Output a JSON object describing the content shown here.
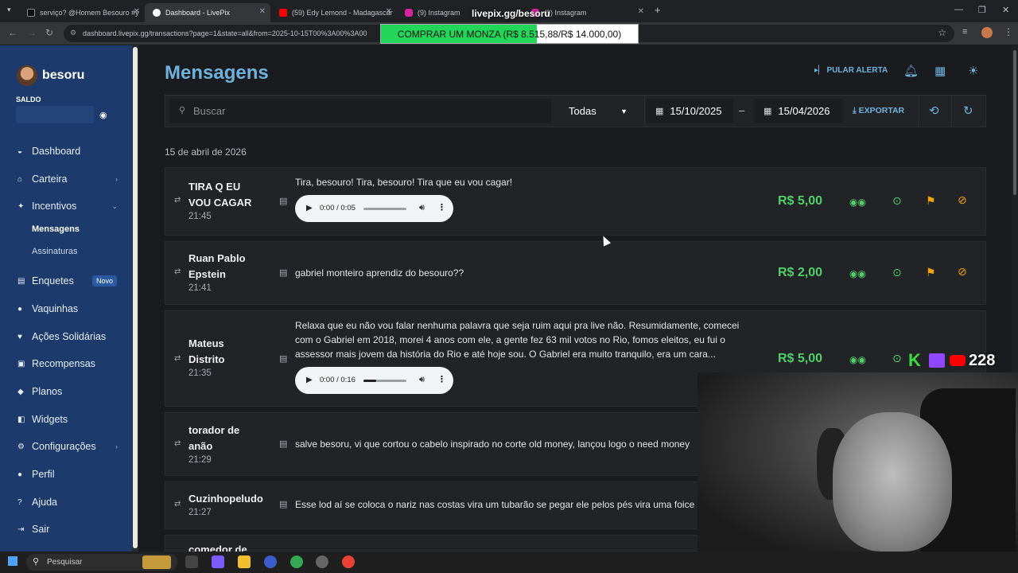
{
  "browser": {
    "tabs": [
      {
        "label": "serviço? @Homem Besouro #y"
      },
      {
        "label": "Dashboard - LivePix"
      },
      {
        "label": "(59) Edy Lemond - Madagascar"
      },
      {
        "label": "(9) Instagram"
      },
      {
        "label": "(9) Instagram"
      }
    ],
    "new_tab": "+",
    "url": "dashboard.livepix.gg/transactions?page=1&state=all&from=2025-10-15T00%3A00%3A00"
  },
  "overlay": {
    "goal_text": "COMPRAR UM MONZA (R$ 8.515,88/R$ 14.000,00)",
    "goal_progress": 0.608,
    "channel_url": "livepix.gg/besoru"
  },
  "sidebar": {
    "username": "besoru",
    "saldo_label": "SALDO",
    "items": [
      {
        "label": "Dashboard",
        "icon": "dashboard-icon"
      },
      {
        "label": "Carteira",
        "icon": "bank-icon"
      },
      {
        "label": "Incentivos",
        "icon": "sparkle-icon"
      },
      {
        "label": "Enquetes",
        "icon": "poll-icon",
        "badge": "Novo"
      },
      {
        "label": "Vaquinhas",
        "icon": "piggy-icon"
      },
      {
        "label": "Ações Solidárias",
        "icon": "heart-icon"
      },
      {
        "label": "Recompensas",
        "icon": "gift-icon"
      },
      {
        "label": "Planos",
        "icon": "plans-icon"
      },
      {
        "label": "Widgets",
        "icon": "widgets-icon"
      },
      {
        "label": "Configurações",
        "icon": "gear-icon"
      },
      {
        "label": "Perfil",
        "icon": "user-icon"
      },
      {
        "label": "Ajuda",
        "icon": "help-icon"
      },
      {
        "label": "Sair",
        "icon": "logout-icon"
      }
    ],
    "subitems": [
      {
        "label": "Mensagens"
      },
      {
        "label": "Assinaturas"
      }
    ]
  },
  "header": {
    "title": "Mensagens",
    "skip_alert": "PULAR ALERTA"
  },
  "filters": {
    "search_placeholder": "Buscar",
    "status": "Todas",
    "from_date": "15/10/2025",
    "date_separator": "–",
    "to_date": "15/04/2026",
    "export_label": "EXPORTAR"
  },
  "date_group": "15 de abril de 2026",
  "messages": [
    {
      "name_line1": "TIRA Q EU",
      "name_line2": "VOU CAGAR",
      "time": "21:45",
      "text": "Tira, besouro! Tira, besouro! Tira que eu vou cagar!",
      "audio_time": "0:00 / 0:05",
      "audio_progress": 0,
      "amount": "R$ 5,00"
    },
    {
      "name_line1": "Ruan Pablo",
      "name_line2": "Epstein",
      "time": "21:41",
      "text": "gabriel monteiro aprendiz do besouro??",
      "amount": "R$ 2,00"
    },
    {
      "name_line1": "Mateus",
      "name_line2": "Distrito",
      "time": "21:35",
      "text_line1": "Relaxa que eu não vou falar nenhuma palavra que seja ruim aqui pra live não. Resumidamente, comecei",
      "text_line2": "com o Gabriel em 2018, morei 4 anos com ele, a gente fez 63 mil votos no Rio, fomos eleitos, eu fui o",
      "text_line3": "assessor mais jovem da história do Rio e até hoje sou. O Gabriel era muito tranquilo, era um cara...",
      "audio_time": "0:00 / 0:16",
      "audio_progress": 0.3,
      "amount": "R$ 5,00"
    },
    {
      "name_line1": "torador de",
      "name_line2": "anão",
      "time": "21:29",
      "text": "salve besoru, vi que cortou o cabelo inspirado no corte old money, lançou logo o need money"
    },
    {
      "name_line1": "Cuzinhopeludo",
      "time": "21:27",
      "text": "Esse lod aí se coloca o nariz nas costas vira um tubarão se pegar ele pelos pés vira uma foice"
    },
    {
      "name_line1": "comedor de"
    }
  ],
  "stream": {
    "viewers": "228"
  },
  "taskbar": {
    "search_label": "Pesquisar"
  },
  "colors": {
    "sidebar": "#1c3a6b",
    "accent": "#6fb2de",
    "amount": "#4fd068",
    "flag": "#f0a500",
    "goal_fill": "#22d65a"
  }
}
